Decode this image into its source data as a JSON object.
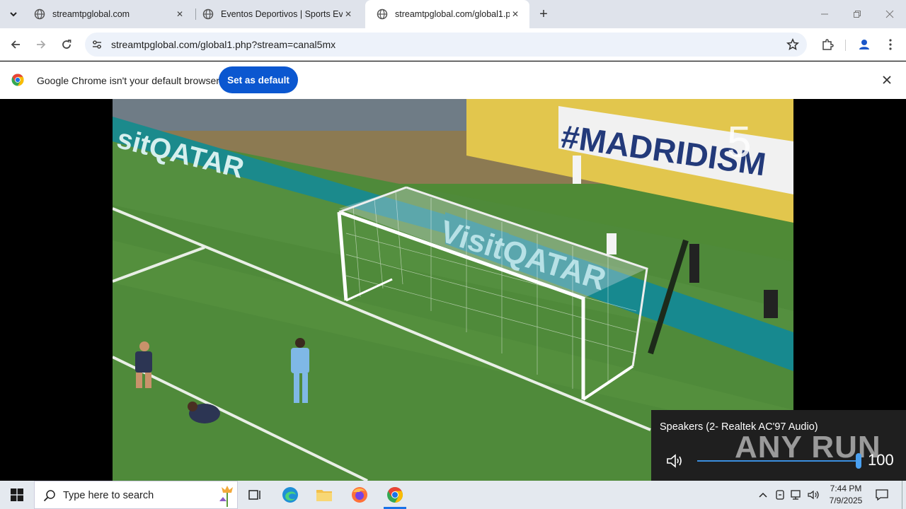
{
  "tabs": [
    {
      "title": "streamtpglobal.com",
      "active": false
    },
    {
      "title": "Eventos Deportivos | Sports Eve",
      "active": false
    },
    {
      "title": "streamtpglobal.com/global1.ph",
      "active": true
    }
  ],
  "toolbar": {
    "url": "streamtpglobal.com/global1.php?stream=canal5mx"
  },
  "infobar": {
    "message": "Google Chrome isn't your default browser",
    "button_label": "Set as default"
  },
  "video": {
    "banner_left": "sitQATAR",
    "banner_right": "#MADRIDISM",
    "net_text": "VisitQATAR",
    "channel_logo": "5"
  },
  "volume": {
    "device": "Speakers (2- Realtek AC'97 Audio)",
    "level": "100",
    "level_fraction": 1.0,
    "watermark": "ANY RUN"
  },
  "taskbar": {
    "search_placeholder": "Type here to search",
    "time": "7:44 PM",
    "date": "7/9/2025"
  },
  "colors": {
    "accent": "#0b57d0",
    "tabstrip": "#dfe3eb",
    "flyout": "#1f1f1f",
    "volume_blue": "#4aa0f0"
  }
}
